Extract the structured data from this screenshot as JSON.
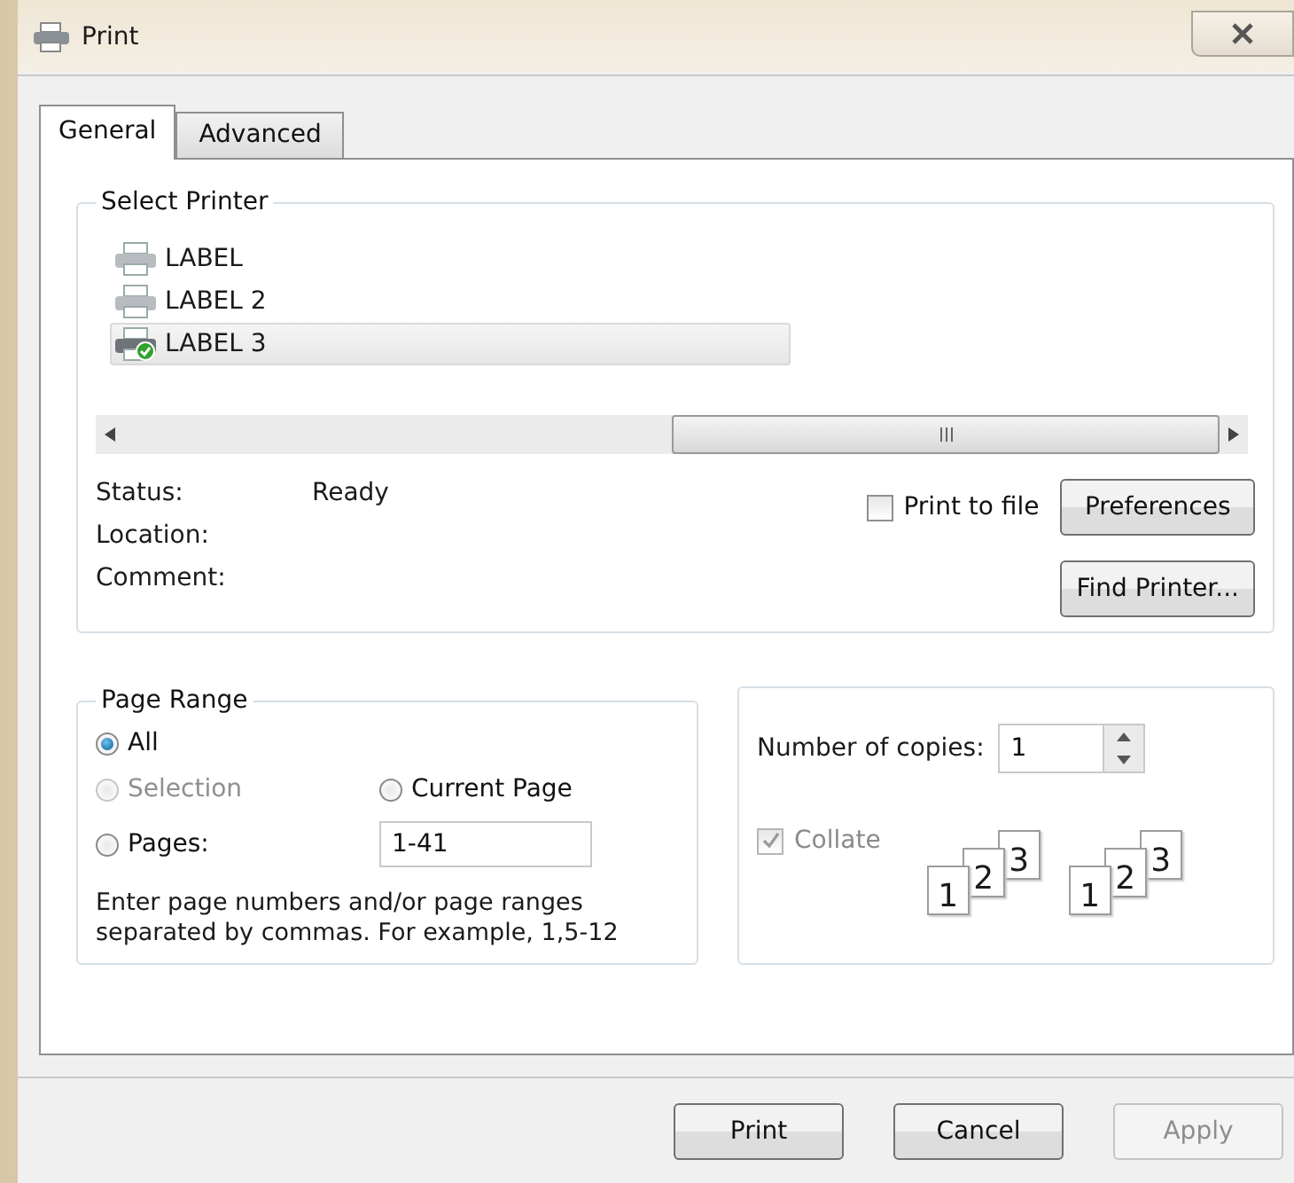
{
  "window": {
    "title": "Print"
  },
  "tabs": [
    {
      "label": "General",
      "selected": true
    },
    {
      "label": "Advanced",
      "selected": false
    }
  ],
  "select_printer": {
    "title": "Select Printer",
    "printers": [
      {
        "name": "LABEL",
        "selected": false,
        "default": false
      },
      {
        "name": "LABEL 2",
        "selected": false,
        "default": false
      },
      {
        "name": "LABEL 3",
        "selected": true,
        "default": true
      }
    ],
    "status": [
      {
        "label": "Status:",
        "value": "Ready"
      },
      {
        "label": "Location:"
      },
      {
        "label": "Comment:"
      }
    ],
    "print_to_file": {
      "label": "Print to file",
      "checked": false
    },
    "buttons": [
      "Preferences",
      "Find Printer..."
    ]
  },
  "page_range": {
    "title": "Page Range",
    "options": [
      {
        "label": "All",
        "selected": true,
        "disabled": false
      },
      {
        "label": "Selection",
        "selected": false,
        "disabled": true
      },
      {
        "label": "Current Page",
        "selected": false,
        "disabled": false
      },
      {
        "label": "Pages:",
        "selected": false,
        "disabled": false
      }
    ],
    "pages_value": "1-41",
    "hint": "Enter page numbers and/or page ranges\nseparated by commas.  For example, 1,5-12"
  },
  "copies": {
    "label": "Number of copies:",
    "value": "1",
    "collate": {
      "label": "Collate",
      "checked": true,
      "disabled": true
    },
    "stacks": [
      [
        "1",
        "2",
        "3"
      ],
      [
        "1",
        "2",
        "3"
      ]
    ]
  },
  "footer_buttons": [
    {
      "label": "Print",
      "disabled": false
    },
    {
      "label": "Cancel",
      "disabled": false
    },
    {
      "label": "Apply",
      "disabled": true
    }
  ]
}
